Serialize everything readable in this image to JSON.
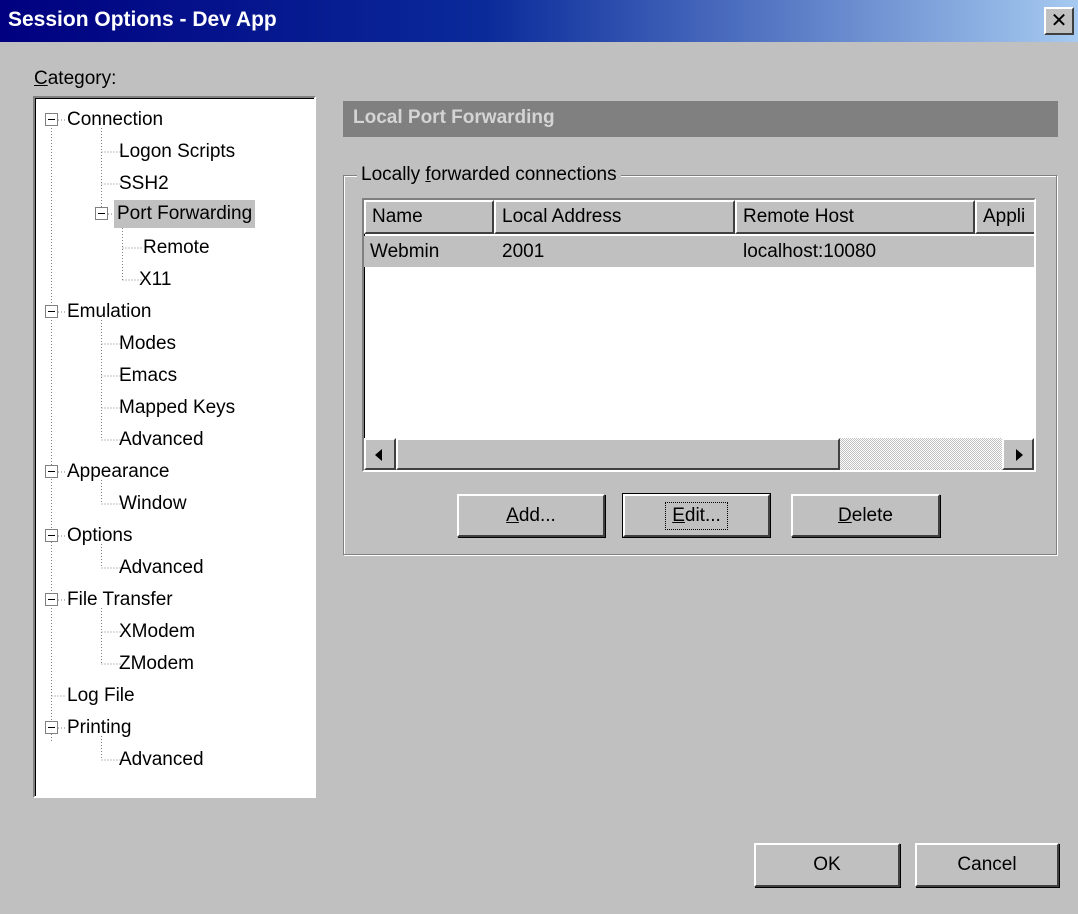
{
  "window": {
    "title": "Session Options - Dev App",
    "close_glyph": "✕"
  },
  "category": {
    "label_accel": "C",
    "label_rest": "ategory:"
  },
  "tree": {
    "items": [
      {
        "label": "Connection"
      },
      {
        "label": "Logon Scripts"
      },
      {
        "label": "SSH2"
      },
      {
        "label": "Port Forwarding"
      },
      {
        "label": "Remote"
      },
      {
        "label": "X11"
      },
      {
        "label": "Emulation"
      },
      {
        "label": "Modes"
      },
      {
        "label": "Emacs"
      },
      {
        "label": "Mapped Keys"
      },
      {
        "label": "Advanced"
      },
      {
        "label": "Appearance"
      },
      {
        "label": "Window"
      },
      {
        "label": "Options"
      },
      {
        "label": "Advanced"
      },
      {
        "label": "File Transfer"
      },
      {
        "label": "XModem"
      },
      {
        "label": "ZModem"
      },
      {
        "label": "Log File"
      },
      {
        "label": "Printing"
      },
      {
        "label": "Advanced"
      }
    ],
    "selected": "Port Forwarding"
  },
  "page": {
    "header": "Local Port Forwarding"
  },
  "group": {
    "label_pre": "Locally ",
    "label_accel": "f",
    "label_post": "orwarded connections"
  },
  "list": {
    "columns": [
      "Name",
      "Local Address",
      "Remote Host",
      "Appli"
    ],
    "rows": [
      {
        "name": "Webmin",
        "local_address": "2001",
        "remote_host": "localhost:10080",
        "application": ""
      }
    ]
  },
  "buttons": {
    "add": {
      "accel": "A",
      "rest": "dd..."
    },
    "edit": {
      "accel": "E",
      "rest": "dit..."
    },
    "delete": {
      "accel": "D",
      "rest": "elete"
    },
    "ok": "OK",
    "cancel": "Cancel"
  },
  "colors": {
    "title_start": "#000080",
    "title_end": "#a6caf0",
    "face": "#c0c0c0",
    "header": "#808080"
  }
}
